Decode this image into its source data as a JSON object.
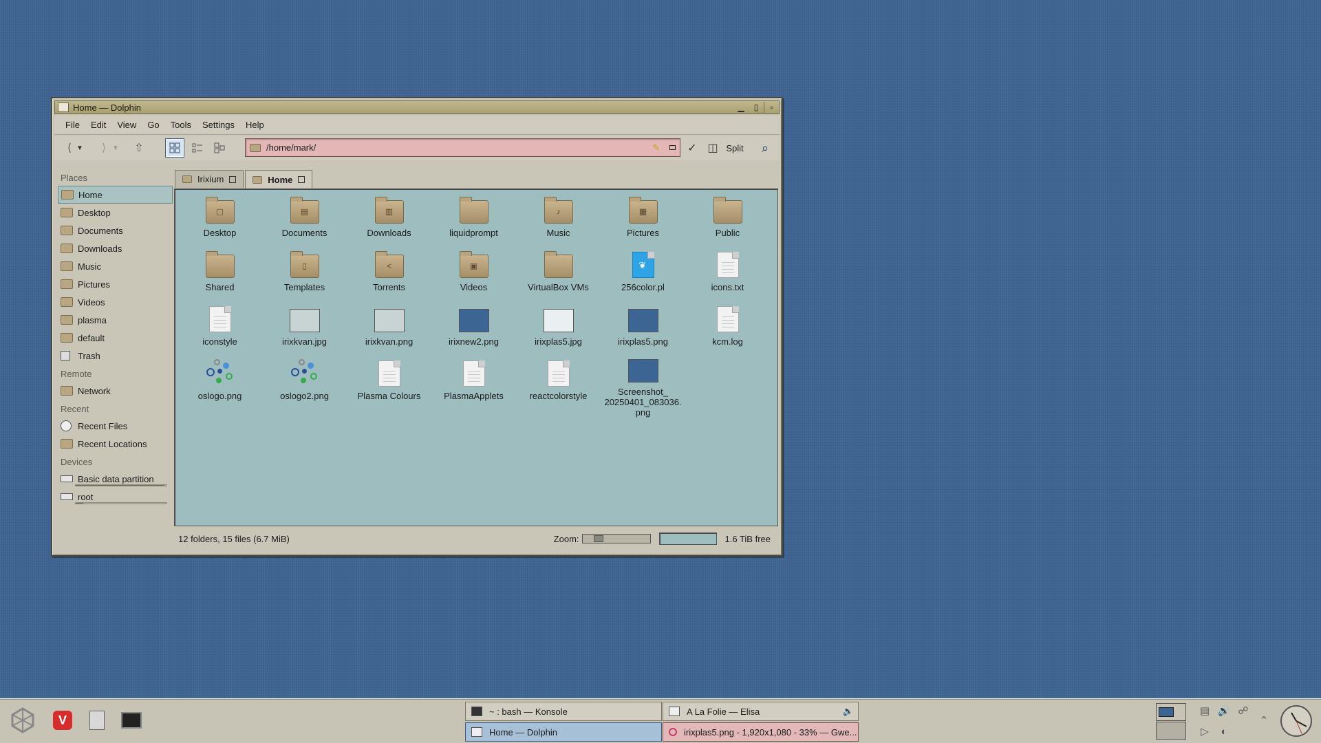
{
  "window": {
    "title": "Home — Dolphin",
    "menu": [
      "File",
      "Edit",
      "View",
      "Go",
      "Tools",
      "Settings",
      "Help"
    ],
    "address": "/home/mark/",
    "split_label": "Split",
    "tabs": [
      {
        "label": "Irixium"
      },
      {
        "label": "Home"
      }
    ],
    "active_tab": "Home"
  },
  "sidebar": {
    "places_header": "Places",
    "places": [
      "Home",
      "Desktop",
      "Documents",
      "Downloads",
      "Music",
      "Pictures",
      "Videos",
      "plasma",
      "default",
      "Trash"
    ],
    "remote_header": "Remote",
    "remote": [
      "Network"
    ],
    "recent_header": "Recent",
    "recent": [
      "Recent Files",
      "Recent Locations"
    ],
    "devices_header": "Devices",
    "devices": [
      {
        "label": "Basic data partition",
        "used_fraction": 0.98
      },
      {
        "label": "root",
        "used_fraction": 0.08
      }
    ]
  },
  "files": [
    {
      "name": "Desktop",
      "kind": "folder",
      "badge": "▢"
    },
    {
      "name": "Documents",
      "kind": "folder",
      "badge": "▤"
    },
    {
      "name": "Downloads",
      "kind": "folder",
      "badge": "▥"
    },
    {
      "name": "liquidprompt",
      "kind": "folder",
      "badge": ""
    },
    {
      "name": "Music",
      "kind": "folder",
      "badge": "♪"
    },
    {
      "name": "Pictures",
      "kind": "folder",
      "badge": "▦"
    },
    {
      "name": "Public",
      "kind": "folder",
      "badge": ""
    },
    {
      "name": "Shared",
      "kind": "folder",
      "badge": ""
    },
    {
      "name": "Templates",
      "kind": "folder",
      "badge": "▯"
    },
    {
      "name": "Torrents",
      "kind": "folder",
      "badge": "<"
    },
    {
      "name": "Videos",
      "kind": "folder",
      "badge": "▣"
    },
    {
      "name": "VirtualBox VMs",
      "kind": "folder",
      "badge": ""
    },
    {
      "name": "256color.pl",
      "kind": "perl",
      "badge": ""
    },
    {
      "name": "icons.txt",
      "kind": "doc",
      "badge": ""
    },
    {
      "name": "iconstyle",
      "kind": "doc",
      "badge": ""
    },
    {
      "name": "irixkvan.jpg",
      "kind": "img-light",
      "badge": ""
    },
    {
      "name": "irixkvan.png",
      "kind": "img-light",
      "badge": ""
    },
    {
      "name": "irixnew2.png",
      "kind": "img",
      "badge": ""
    },
    {
      "name": "irixplas5.jpg",
      "kind": "img-white",
      "badge": ""
    },
    {
      "name": "irixplas5.png",
      "kind": "img",
      "badge": ""
    },
    {
      "name": "kcm.log",
      "kind": "doc",
      "badge": ""
    },
    {
      "name": "oslogo.png",
      "kind": "logo",
      "badge": ""
    },
    {
      "name": "oslogo2.png",
      "kind": "logo",
      "badge": ""
    },
    {
      "name": "Plasma Colours",
      "kind": "doc",
      "badge": ""
    },
    {
      "name": "PlasmaApplets",
      "kind": "doc",
      "badge": ""
    },
    {
      "name": "reactcolorstyle",
      "kind": "doc",
      "badge": ""
    },
    {
      "name": "Screenshot_\n20250401_083036.\npng",
      "kind": "img",
      "badge": ""
    }
  ],
  "status": {
    "summary": "12 folders, 15 files (6.7 MiB)",
    "zoom_label": "Zoom:",
    "free": "1.6 TiB free"
  },
  "taskbar": {
    "tasks": [
      {
        "label": "~ : bash — Konsole",
        "row": "top",
        "col": "left"
      },
      {
        "label": "A La Folie — Elisa",
        "row": "top",
        "col": "right"
      },
      {
        "label": "Home — Dolphin",
        "row": "bottom",
        "col": "left",
        "active": true
      },
      {
        "label": "irixplas5.png - 1,920x1,080 - 33% — Gwe...",
        "row": "bottom",
        "col": "right",
        "marked": true
      }
    ]
  },
  "colors": {
    "desktop": "#3f6492",
    "window_chrome": "#c9c6b8",
    "titlebar": "#b0a77a",
    "view_background": "#9dbdbe",
    "address_background": "#e4b7b7",
    "selection": "#a9c3c3"
  },
  "icons": [
    "app-menu-icon",
    "vivaldi-icon",
    "file-manager-icon",
    "terminal-icon",
    "clipboard-icon",
    "volume-icon",
    "network-icon",
    "clock-icon"
  ]
}
